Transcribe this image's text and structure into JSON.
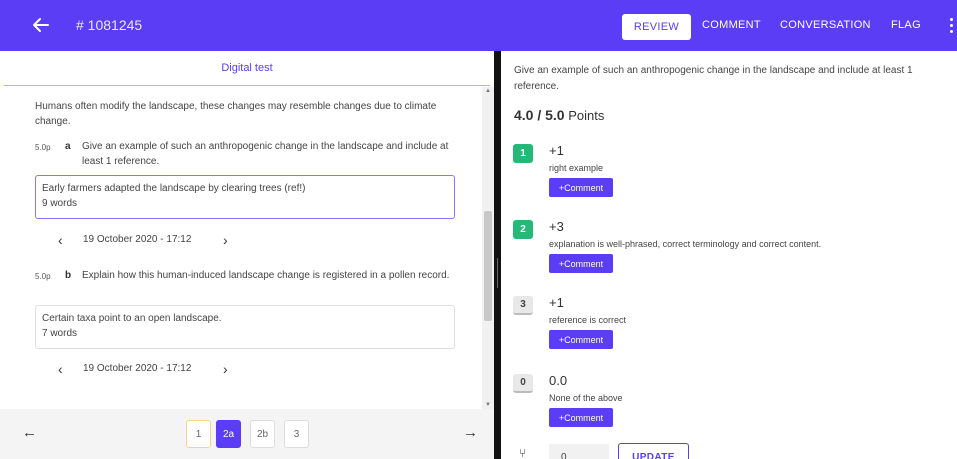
{
  "header": {
    "ticket_id": "# 1081245",
    "tabs": [
      "REVIEW",
      "COMMENT",
      "CONVERSATION",
      "FLAG"
    ],
    "active_tab": "REVIEW"
  },
  "left": {
    "title": "Digital test",
    "intro": "Humans often modify the landscape, these changes may resemble changes due to climate change.",
    "questions": [
      {
        "points": "5.0p",
        "letter": "a",
        "text": "Give an example of such an anthropogenic change in the landscape and include at least 1 reference.",
        "answer": "Early farmers adapted the landscape by clearing trees (ref!)",
        "word_count": "9 words",
        "date": "19 October 2020 - 17:12"
      },
      {
        "points": "5.0p",
        "letter": "b",
        "text": "Explain how this human-induced landscape change is registered in a pollen record.",
        "answer": "Certain taxa point to an open landscape.",
        "word_count": "7 words",
        "date": "19 October 2020 - 17:12"
      }
    ],
    "pager": [
      "1",
      "2a",
      "2b",
      "3"
    ],
    "current_page": "2a"
  },
  "right": {
    "question": "Give an example of such an anthropogenic change in the landscape and include at least 1 reference.",
    "score": "4.0 / 5.0",
    "score_unit": "Points",
    "comment_label": "+Comment",
    "criteria": [
      {
        "badge": "1",
        "score": "+1",
        "description": "right example",
        "selected": true
      },
      {
        "badge": "2",
        "score": "+3",
        "description": "explanation is well-phrased, correct terminology and correct content.",
        "selected": true
      },
      {
        "badge": "3",
        "score": "+1",
        "description": "reference is correct",
        "selected": false
      },
      {
        "badge": "0",
        "score": "0.0",
        "description": "None of the above",
        "selected": false
      }
    ],
    "adjust_value": "0",
    "update_label": "UPDATE"
  },
  "colors": {
    "accent": "#5b3df5",
    "selected": "#25b978"
  }
}
